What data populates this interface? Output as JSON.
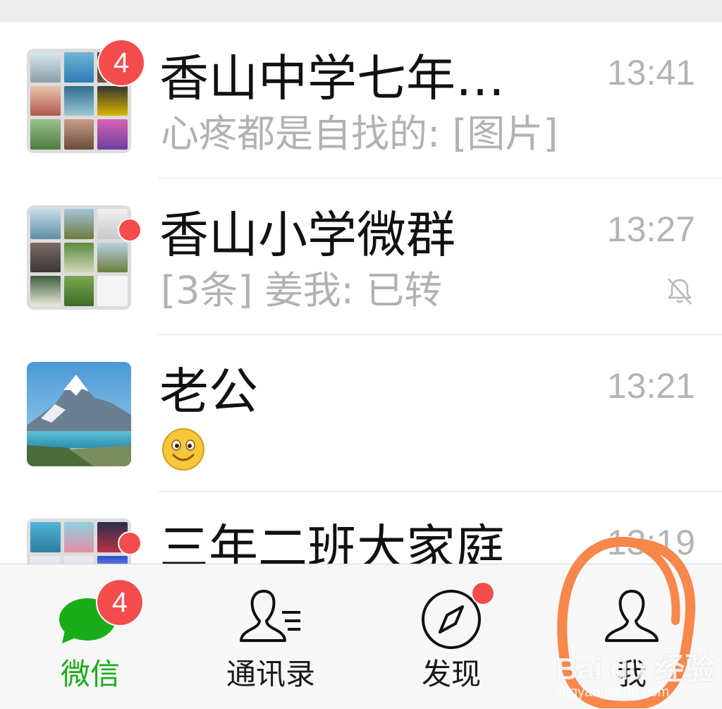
{
  "chats": [
    {
      "title": "香山中学七年…",
      "message": "心疼都是自找的: [图片]",
      "time": "13:41",
      "badge": "4"
    },
    {
      "title": "香山小学微群",
      "message": "[3条] 姜我: 已转",
      "time": "13:27",
      "muted": true
    },
    {
      "title": "老公",
      "message_emoji": "smiley",
      "time": "13:21"
    },
    {
      "title": "三年二班大家庭",
      "time": "13:19"
    }
  ],
  "tabbar": {
    "tabs": [
      {
        "label": "微信",
        "icon": "chat-bubbles-icon",
        "badge": "4",
        "active": true
      },
      {
        "label": "通讯录",
        "icon": "contacts-icon"
      },
      {
        "label": "发现",
        "icon": "compass-icon",
        "dot": true
      },
      {
        "label": "我",
        "icon": "person-icon"
      }
    ]
  },
  "watermark": {
    "brand": "Bai du 经验",
    "url": "jingyan.baidu.com"
  },
  "colors": {
    "accent": "#1aad19",
    "badge": "#f44c4c",
    "annotation": "#f7874a"
  }
}
